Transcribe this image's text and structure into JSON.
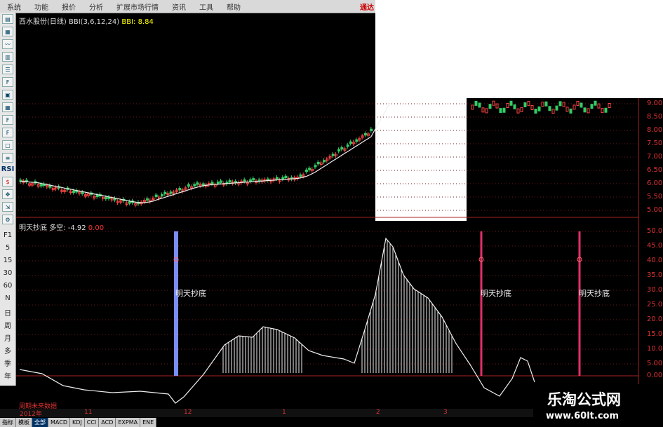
{
  "menu": [
    "系统",
    "功能",
    "报价",
    "分析",
    "扩展市场行情",
    "资讯",
    "工具",
    "帮助"
  ],
  "menu_brand": "通达",
  "toolbar_text": [
    "RSI",
    "F1",
    "5",
    "15",
    "30",
    "60",
    "N",
    "日",
    "周",
    "月",
    "多",
    "季",
    "年"
  ],
  "stock_title": "西水股份(日线)",
  "indicator_bbi": "BBI(3,6,12,24)",
  "bbi_value": "BBI: 8.84",
  "indicator_name": "明天抄底",
  "dk_label": "多空: -4.92",
  "dk_aux": "0.00",
  "price_axis": [
    "9.00",
    "8.50",
    "8.00",
    "7.50",
    "7.00",
    "6.50",
    "6.00",
    "5.50",
    "5.00"
  ],
  "ind_axis": [
    "50.00",
    "45.00",
    "40.00",
    "35.00",
    "30.00",
    "25.00",
    "20.00",
    "15.00",
    "10.00",
    "5.00",
    "0.00"
  ],
  "signal_text": "明天抄底",
  "time_labels": [
    "2012年",
    "11",
    "12",
    "1",
    "2",
    "3"
  ],
  "future_label": "周期未来数据",
  "tabs": [
    "指标",
    "模板",
    "全部",
    "MACD",
    "KDJ",
    "CCI",
    "ACD",
    "EXPMA",
    "ENE"
  ],
  "watermark": {
    "title": "乐淘公式网",
    "url": "www.60lt.com"
  }
}
